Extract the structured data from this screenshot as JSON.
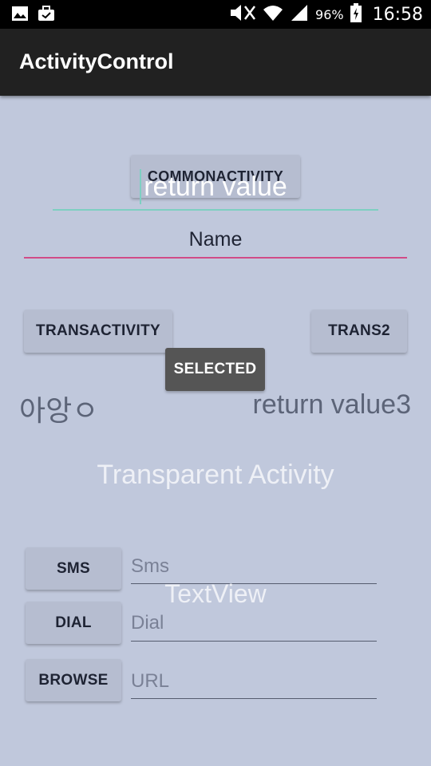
{
  "status_bar": {
    "battery": "96%",
    "time": "16:58",
    "icons": [
      "image-icon",
      "briefcase-icon",
      "mute-icon",
      "wifi-icon",
      "signal-icon",
      "battery-icon"
    ]
  },
  "app_bar": {
    "title": "ActivityControl"
  },
  "main": {
    "common_button": "COMMONACTIVITY",
    "return_value_text": "return value",
    "name_input_value": "Name",
    "transactivity_button": "TRANSACTIVITY",
    "trans2_button": "TRANS2",
    "selected_button": "SELECTED",
    "korean_text": "아앙ㅇ",
    "return_value3_text": "return value3",
    "transparent_activity_text": "Transparent Activity",
    "textview_text": "TextView",
    "sms_button": "SMS",
    "sms_placeholder": "Sms",
    "dial_button": "DIAL",
    "dial_placeholder": "Dial",
    "browse_button": "BROWSE",
    "url_placeholder": "URL"
  },
  "colors": {
    "background": "#c0c8dc",
    "app_bar": "#212121",
    "teal_underline": "#7ecfc2",
    "pink_underline": "#d14b87"
  }
}
